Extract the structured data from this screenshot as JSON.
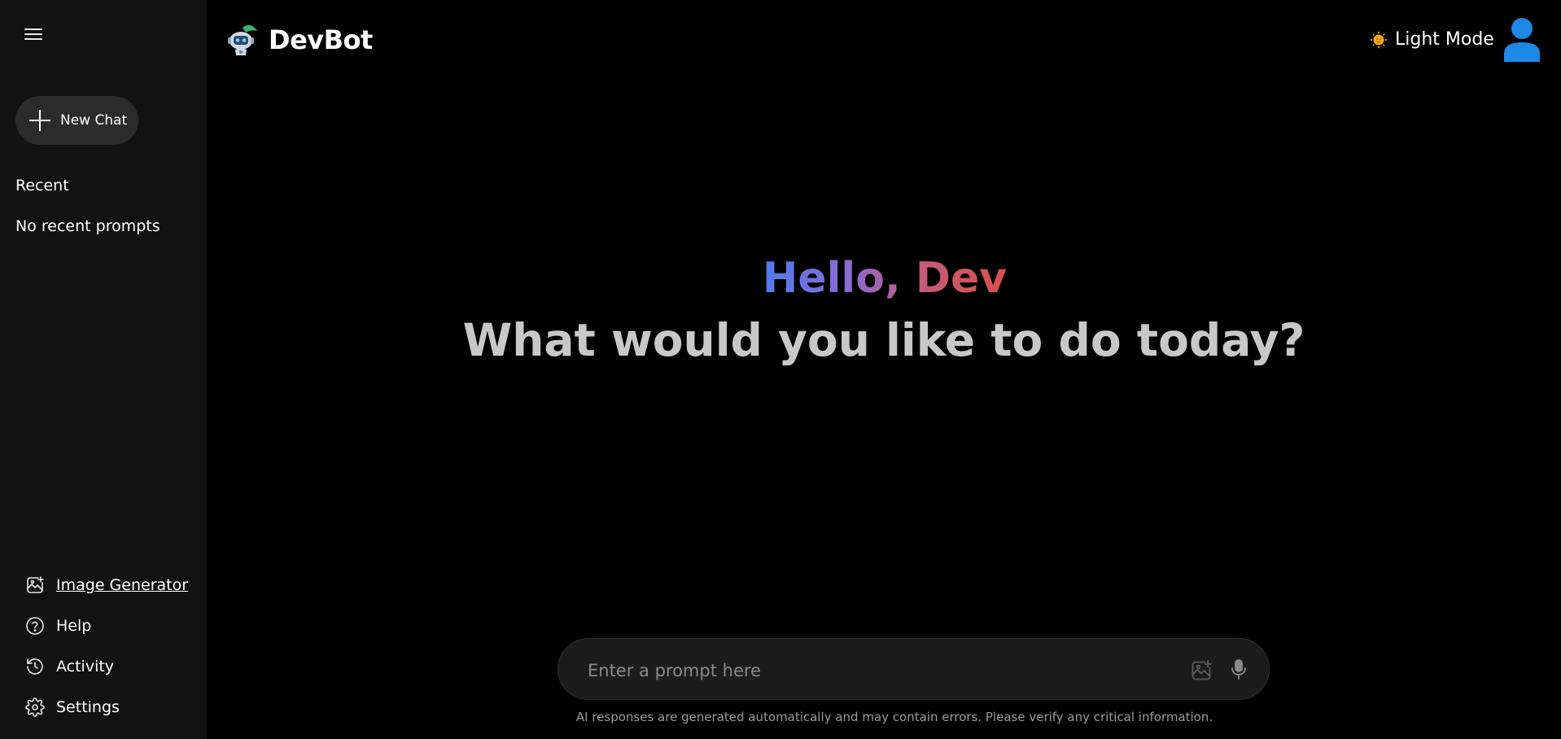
{
  "sidebar": {
    "new_chat_label": "New Chat",
    "recent_title": "Recent",
    "no_recent_text": "No recent prompts",
    "nav": [
      {
        "label": "Image Generator",
        "icon": "image-plus-icon"
      },
      {
        "label": "Help",
        "icon": "help-circle-icon"
      },
      {
        "label": "Activity",
        "icon": "history-icon"
      },
      {
        "label": "Settings",
        "icon": "gear-icon"
      }
    ]
  },
  "header": {
    "brand_name": "DevBot",
    "mode_label": "Light Mode",
    "mode_icon": "sun-icon",
    "avatar_icon": "user-avatar-icon"
  },
  "greeting": {
    "hello": "Hello, Dev",
    "question": "What would you like to do today?"
  },
  "prompt": {
    "placeholder": "Enter a prompt here",
    "value": ""
  },
  "disclaimer": "AI responses are generated automatically and may contain errors. Please verify any critical information.",
  "colors": {
    "sidebar_bg": "#121212",
    "main_bg": "#000000",
    "new_chat_bg": "#2b2b2b",
    "gradient_start": "#4d7cf0",
    "gradient_end": "#d9504a",
    "avatar_blue": "#1e88e5",
    "sun_orange": "#f5a623"
  }
}
